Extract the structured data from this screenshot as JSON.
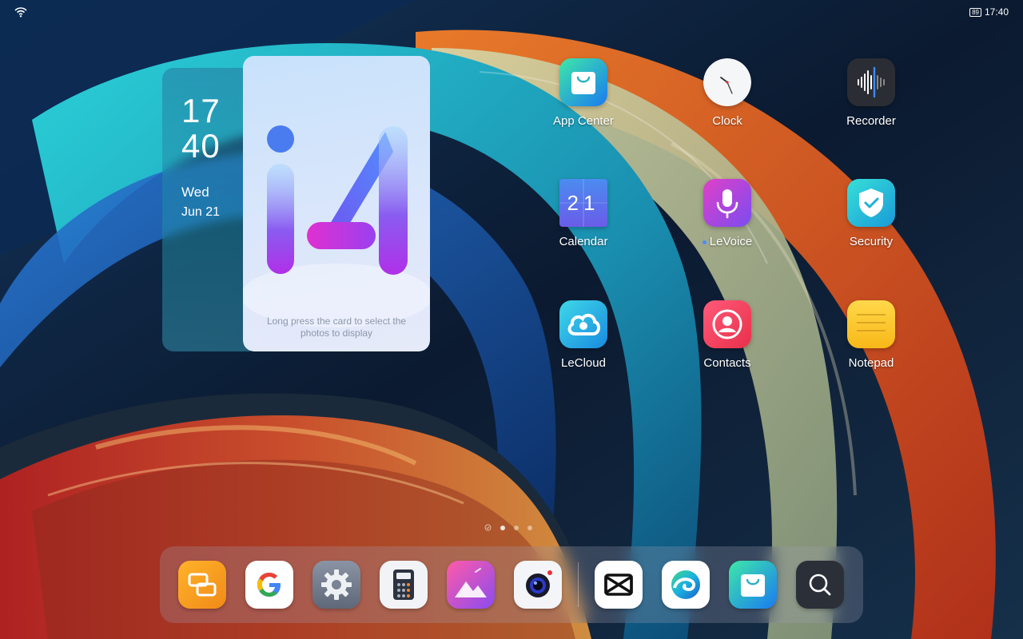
{
  "status_bar": {
    "battery": "89",
    "time": "17:40"
  },
  "widget": {
    "hour": "17",
    "minute": "40",
    "day": "Wed",
    "date": "Jun 21",
    "hint": "Long press the card to select the photos to display"
  },
  "apps": [
    {
      "label": "App Center",
      "icon": "bag-icon"
    },
    {
      "label": "Clock",
      "icon": "clock-icon"
    },
    {
      "label": "Recorder",
      "icon": "waveform-icon"
    },
    {
      "label": "Calendar",
      "icon": "calendar-icon",
      "day": "21"
    },
    {
      "label": "LeVoice",
      "icon": "microphone-icon"
    },
    {
      "label": "Security",
      "icon": "shield-check-icon"
    },
    {
      "label": "LeCloud",
      "icon": "cloud-icon"
    },
    {
      "label": "Contacts",
      "icon": "person-icon"
    },
    {
      "label": "Notepad",
      "icon": "notepad-icon"
    }
  ],
  "dock": [
    {
      "icon": "office-suite-icon"
    },
    {
      "icon": "google-icon"
    },
    {
      "icon": "settings-gear-icon"
    },
    {
      "icon": "calculator-icon"
    },
    {
      "icon": "gallery-icon"
    },
    {
      "icon": "camera-icon"
    },
    {
      "icon": "capcut-icon"
    },
    {
      "icon": "edge-browser-icon"
    },
    {
      "icon": "app-center-bag-icon"
    },
    {
      "icon": "search-icon"
    }
  ],
  "pager": {
    "pages": 3,
    "active": 1
  }
}
